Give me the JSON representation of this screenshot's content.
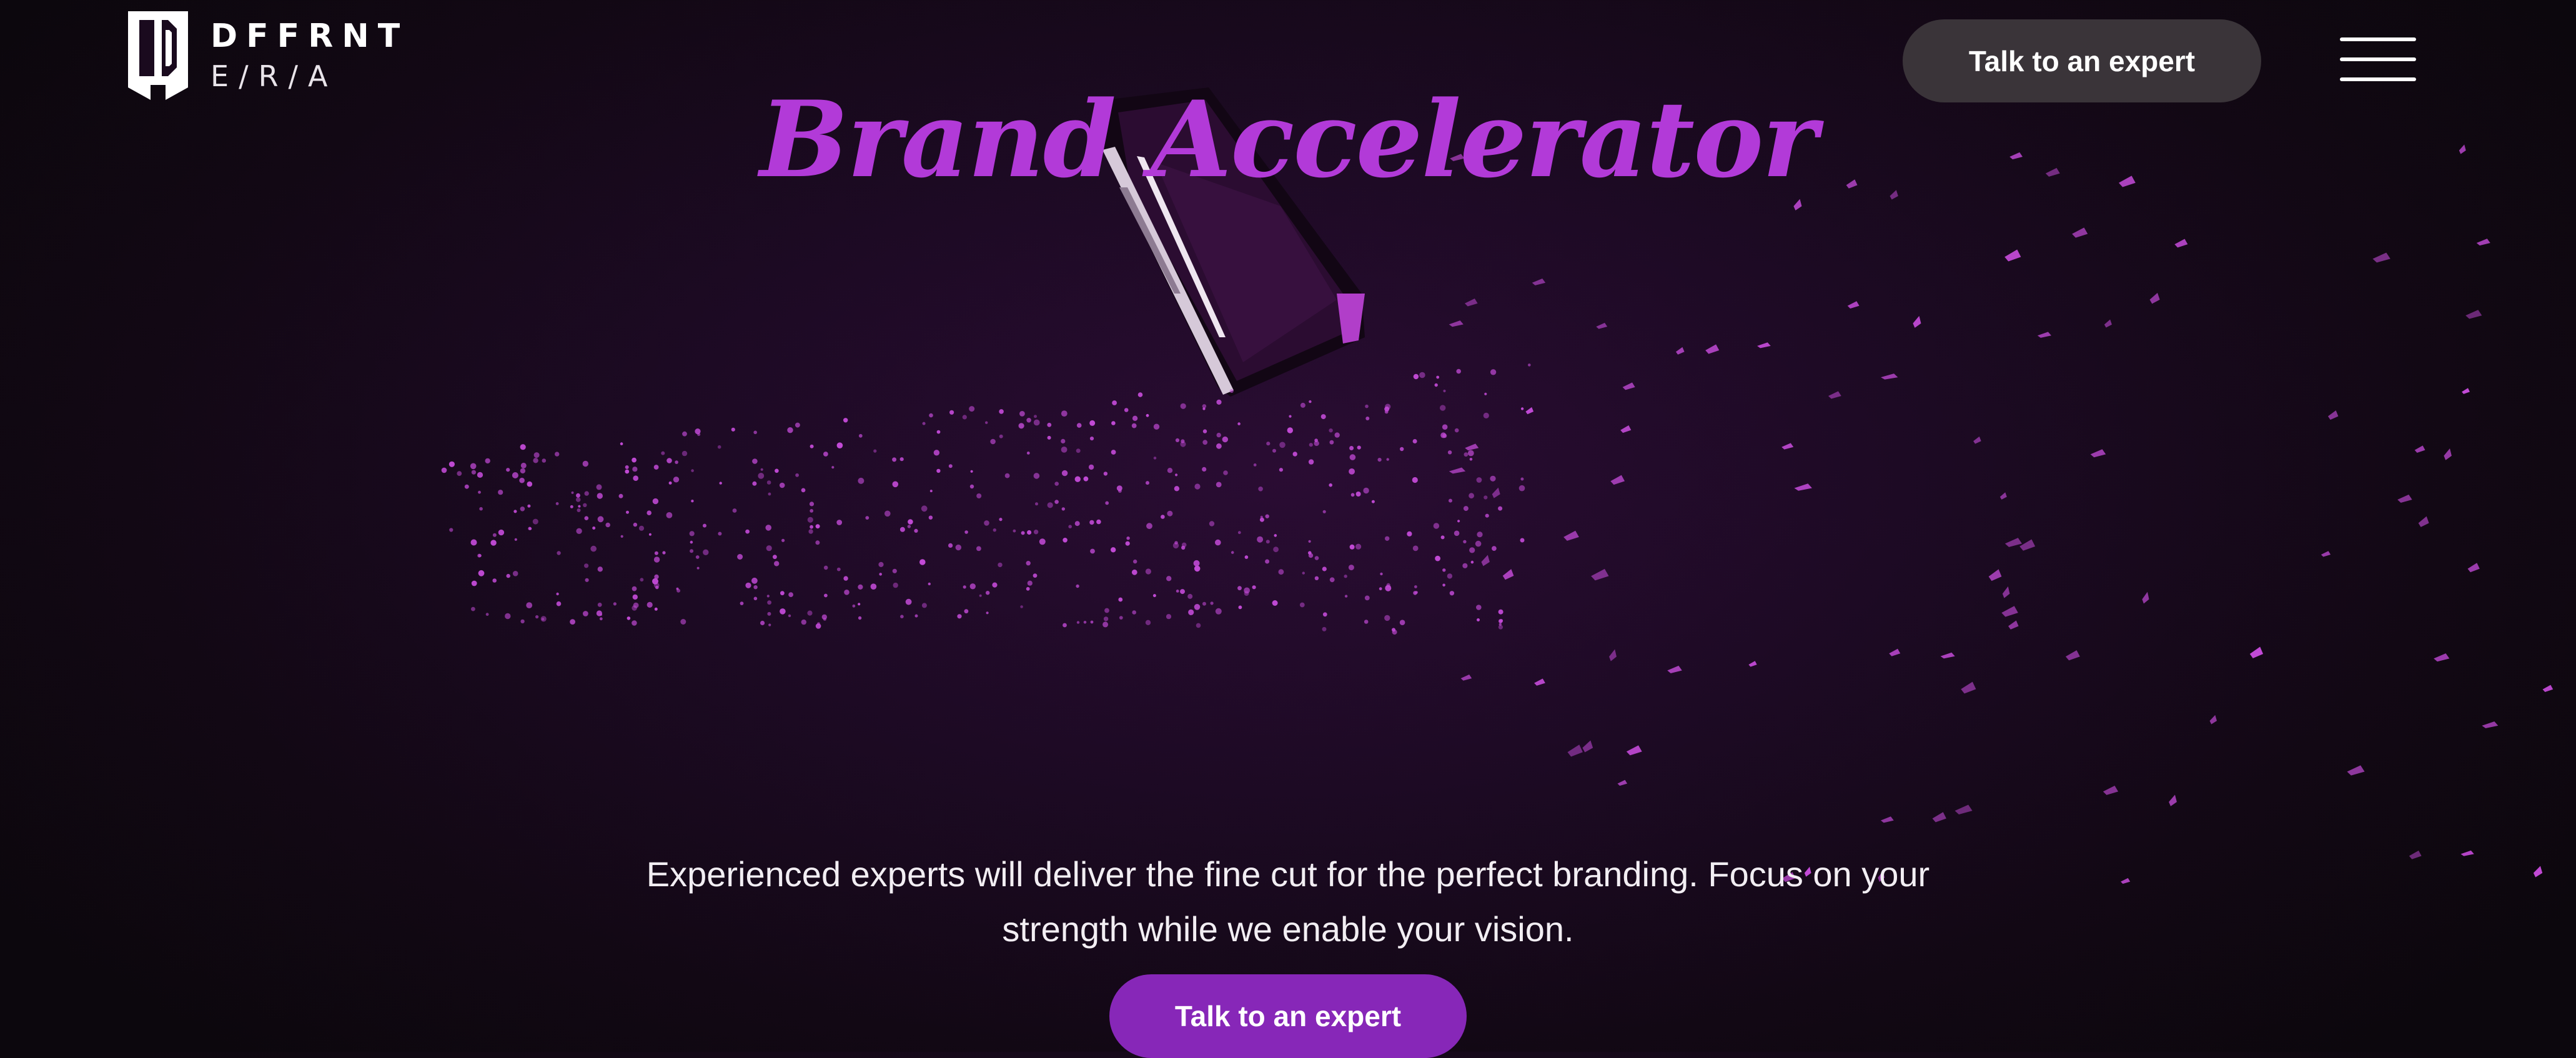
{
  "logo": {
    "line1": "DFFRNT",
    "line2": "E/R/A"
  },
  "hero": {
    "title": "Brand Accelerator",
    "subtitle_line1": "Experienced experts will deliver the fine cut for the perfect branding. Focus on your",
    "subtitle_line2": "strength while we enable your vision."
  },
  "header": {
    "cta_label": "Talk to an expert",
    "menu_icon": "hamburger-menu-icon"
  },
  "main": {
    "cta_label": "Talk to an expert",
    "visual": "dark-crystal-gem"
  },
  "colors": {
    "title": "#b23ad8",
    "primary_button": "#8727b8",
    "header_button": "#3a3439",
    "particles": "#c24ad6",
    "background": "#1d0a24"
  }
}
